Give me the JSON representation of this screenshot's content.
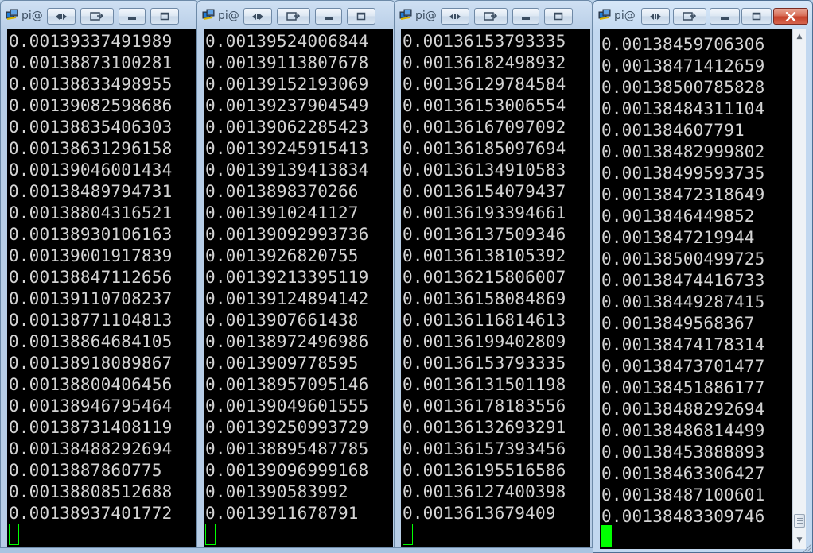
{
  "windows": [
    {
      "title": "pi@",
      "active": false,
      "lines": [
        "0.00139337491989",
        "0.00138873100281",
        "0.00138833498955",
        "0.00139082598686",
        "0.00138835406303",
        "0.00138631296158",
        "0.00139046001434",
        "0.00138489794731",
        "0.00138804316521",
        "0.00138930106163",
        "0.00139001917839",
        "0.00138847112656",
        "0.00139110708237",
        "0.00138771104813",
        "0.00138864684105",
        "0.00138918089867",
        "0.00138800406456",
        "0.00138946795464",
        "0.00138731408119",
        "0.00138488292694",
        "0.0013887860775",
        "0.00138808512688",
        "0.00138937401772"
      ]
    },
    {
      "title": "pi@",
      "active": false,
      "lines": [
        "0.00139524006844",
        "0.00139113807678",
        "0.00139152193069",
        "0.00139237904549",
        "0.00139062285423",
        "0.00139245915413",
        "0.00139139413834",
        "0.0013898370266",
        "0.0013910241127",
        "0.00139092993736",
        "0.0013926820755",
        "0.00139213395119",
        "0.00139124894142",
        "0.0013907661438",
        "0.00138972496986",
        "0.0013909778595",
        "0.00138957095146",
        "0.00139049601555",
        "0.00139250993729",
        "0.00138895487785",
        "0.00139096999168",
        "0.001390583992",
        "0.0013911678791"
      ]
    },
    {
      "title": "pi@",
      "active": false,
      "lines": [
        "0.00136153793335",
        "0.00136182498932",
        "0.00136129784584",
        "0.00136153006554",
        "0.00136167097092",
        "0.00136185097694",
        "0.00136134910583",
        "0.00136154079437",
        "0.00136193394661",
        "0.00136137509346",
        "0.00136138105392",
        "0.00136215806007",
        "0.00136158084869",
        "0.00136116814613",
        "0.00136199402809",
        "0.00136153793335",
        "0.00136131501198",
        "0.00136178183556",
        "0.00136132693291",
        "0.00136157393456",
        "0.00136195516586",
        "0.00136127400398",
        "0.0013613679409"
      ]
    },
    {
      "title": "pi@",
      "active": true,
      "lines": [
        "0.00138459706306",
        "0.00138471412659",
        "0.00138500785828",
        "0.00138484311104",
        "0.001384607791",
        "0.00138482999802",
        "0.00138499593735",
        "0.00138472318649",
        "0.0013846449852",
        "0.0013847219944",
        "0.00138500499725",
        "0.00138474416733",
        "0.00138449287415",
        "0.0013849568367",
        "0.00138474178314",
        "0.00138473701477",
        "0.00138451886177",
        "0.00138488292694",
        "0.00138486814499",
        "0.00138453888893",
        "0.00138463306427",
        "0.00138487100601",
        "0.00138483309746"
      ]
    }
  ],
  "icons": {
    "app": "putty-terminal-icon",
    "restore_left": "restore-left-icon",
    "restore_right": "restore-right-icon",
    "minimize": "minimize-icon",
    "maximize": "maximize-icon",
    "close": "close-icon"
  },
  "colors": {
    "terminal_background": "#000000",
    "terminal_text": "#d4d4d4",
    "cursor": "#00ff00",
    "close_button": "#c5412b"
  }
}
